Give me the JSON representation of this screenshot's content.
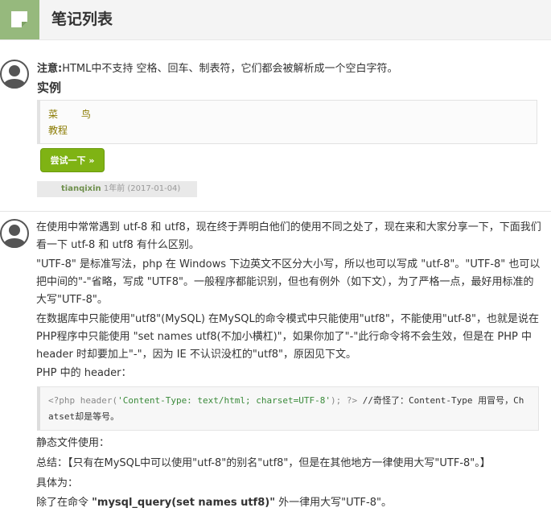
{
  "header": {
    "title": "笔记列表",
    "icon": "note-icon",
    "accent": "#96b97d"
  },
  "note1": {
    "label": "注意:",
    "text": "HTML中不支持 空格、回车、制表符，它们都会被解析成一个空白字符。",
    "example_title": "实例",
    "code_line1": "菜    鸟",
    "code_line2": "教程",
    "try_button": "尝试一下 »",
    "author": "tianqixin",
    "time": "1年前 (2017-01-04)"
  },
  "note2": {
    "p1": "在使用中常常遇到 utf-8 和 utf8，现在终于弄明白他们的使用不同之处了，现在来和大家分享一下，下面我们看一下 utf-8 和 utf8 有什么区别。",
    "p2": "\"UTF-8\" 是标准写法，php 在 Windows 下边英文不区分大小写，所以也可以写成 \"utf-8\"。\"UTF-8\" 也可以把中间的\"-\"省略，写成 \"UTF8\"。一般程序都能识别，但也有例外（如下文），为了严格一点，最好用标准的大写\"UTF-8\"。",
    "p3": "在数据库中只能使用\"utf8\"(MySQL) 在MySQL的命令模式中只能使用\"utf8\"，不能使用\"utf-8\"，也就是说在PHP程序中只能使用 \"set names utf8(不加小横杠)\"，如果你加了\"-\"此行命令将不会生效，但是在 PHP 中 header 时却要加上\"-\"，因为 IE 不认识没杠的\"utf8\"，原因见下文。",
    "p4": "PHP 中的 header：",
    "code_kw1": "<?php header(",
    "code_str": "'Content-Type: text/html; charset=UTF-8'",
    "code_kw2": "); ?>",
    "code_comment": " //奇怪了：Content-Type 用冒号，Ch",
    "code_line2": "atset却是等号。",
    "p5": "静态文件使用：",
    "p6": "总结：【只有在MySQL中可以使用\"utf-8\"的别名\"utf8\"，但是在其他地方一律使用大写\"UTF-8\"。】",
    "p7": "具体为：",
    "p8_pre": "除了在命令 ",
    "p8_bold": "\"mysql_query(set names utf8)\"",
    "p8_post": " 外一律用大写\"UTF-8\"。"
  }
}
